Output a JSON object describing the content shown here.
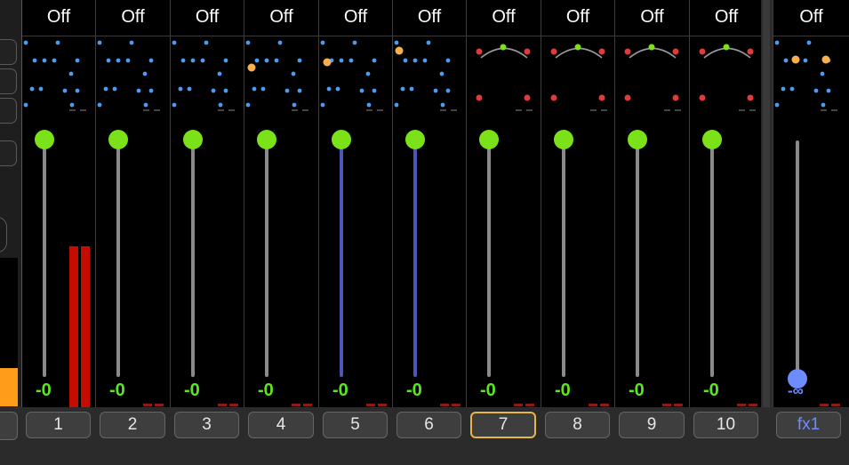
{
  "colors": {
    "fader_knob": "#7be21a",
    "gain_text": "#5ee522",
    "track_grey": "#8a8a8a",
    "track_blue": "#4a57b5",
    "meter_red": "#c40c00",
    "pan_dot": "#4a9cf0",
    "pan_active": "#f8b04a",
    "stereo_red": "#e03a3a",
    "selected_border": "#e8b54a",
    "fx_label": "#6d8dff",
    "fx_knob": "#6d8dff"
  },
  "channels": [
    {
      "id": "1",
      "top": "Off",
      "gain": "-0",
      "pan_type": "mono",
      "active_dot": null,
      "track_color": "blue_no",
      "meter_level": 0.58
    },
    {
      "id": "2",
      "top": "Off",
      "gain": "-0",
      "pan_type": "mono",
      "active_dot": null,
      "meter_level": 0
    },
    {
      "id": "3",
      "top": "Off",
      "gain": "-0",
      "pan_type": "mono",
      "active_dot": null,
      "meter_level": 0
    },
    {
      "id": "4",
      "top": "Off",
      "gain": "-0",
      "pan_type": "mono",
      "active_dot": "mid_left",
      "meter_level": 0
    },
    {
      "id": "5",
      "top": "Off",
      "gain": "-0",
      "pan_type": "mono",
      "active_dot": "left_mid",
      "meter_level": 0
    },
    {
      "id": "6",
      "top": "Off",
      "gain": "-0",
      "pan_type": "mono",
      "active_dot": "upper_left",
      "meter_level": 0
    },
    {
      "id": "7",
      "top": "Off",
      "gain": "-0",
      "pan_type": "stereo",
      "active_dot": null,
      "meter_level": 0
    },
    {
      "id": "8",
      "top": "Off",
      "gain": "-0",
      "pan_type": "stereo",
      "active_dot": null,
      "meter_level": 0
    },
    {
      "id": "9",
      "top": "Off",
      "gain": "-0",
      "pan_type": "stereo",
      "active_dot": null,
      "meter_level": 0
    },
    {
      "id": "10",
      "top": "Off",
      "gain": "-0",
      "pan_type": "stereo",
      "active_dot": null,
      "meter_level": 0
    }
  ],
  "channel_bottom_labels": [
    "1",
    "2",
    "3",
    "4",
    "5",
    "6",
    "7",
    "8",
    "9",
    "10"
  ],
  "selected_channel": "7",
  "fx": {
    "label": "fx1",
    "top": "Off",
    "gain": "-∞"
  },
  "top_labels": [
    "Off",
    "Off",
    "Off",
    "Off",
    "Off",
    "Off",
    "Off",
    "Off",
    "Off",
    "Off"
  ],
  "gains": [
    "-0",
    "-0",
    "-0",
    "-0",
    "-0",
    "-0",
    "-0",
    "-0",
    "-0",
    "-0"
  ]
}
